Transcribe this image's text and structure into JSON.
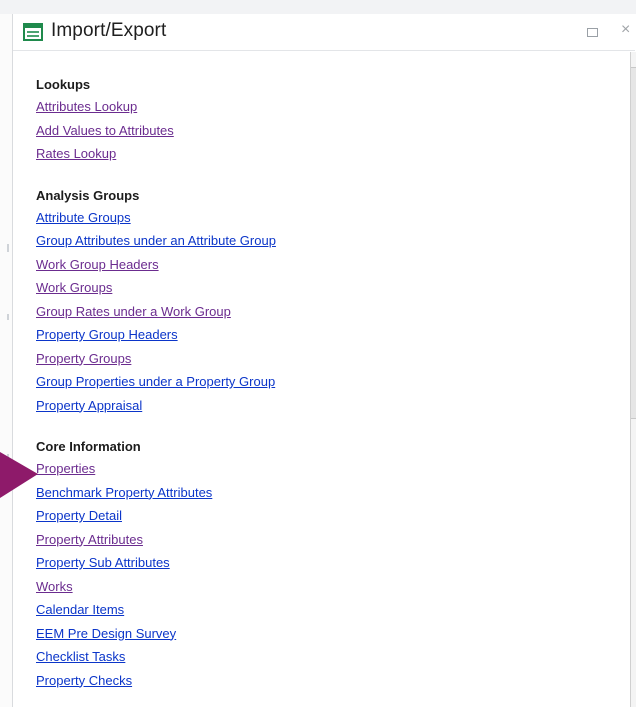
{
  "window": {
    "title": "Import/Export",
    "icon": "form-icon",
    "controls": {
      "restore": "restore-icon",
      "close": "×"
    }
  },
  "sections": [
    {
      "heading": "Lookups",
      "links": [
        {
          "label": "Attributes Lookup",
          "state": "visited"
        },
        {
          "label": "Add Values to Attributes",
          "state": "visited"
        },
        {
          "label": "Rates Lookup",
          "state": "visited"
        }
      ]
    },
    {
      "heading": "Analysis Groups",
      "links": [
        {
          "label": "Attribute Groups",
          "state": "unvisited"
        },
        {
          "label": "Group Attributes under an Attribute Group",
          "state": "unvisited"
        },
        {
          "label": "Work Group Headers",
          "state": "visited"
        },
        {
          "label": "Work Groups",
          "state": "visited"
        },
        {
          "label": "Group Rates under a Work Group",
          "state": "visited"
        },
        {
          "label": "Property Group Headers",
          "state": "unvisited"
        },
        {
          "label": "Property Groups",
          "state": "visited"
        },
        {
          "label": "Group Properties under a Property Group",
          "state": "unvisited"
        },
        {
          "label": "Property Appraisal",
          "state": "unvisited"
        }
      ]
    },
    {
      "heading": "Core Information",
      "links": [
        {
          "label": "Properties",
          "state": "visited"
        },
        {
          "label": "Benchmark Property Attributes",
          "state": "unvisited"
        },
        {
          "label": "Property Detail",
          "state": "unvisited"
        },
        {
          "label": "Property Attributes",
          "state": "visited"
        },
        {
          "label": "Property Sub Attributes",
          "state": "unvisited"
        },
        {
          "label": "Works",
          "state": "visited"
        },
        {
          "label": "Calendar Items",
          "state": "unvisited"
        },
        {
          "label": "EEM Pre Design Survey",
          "state": "unvisited"
        },
        {
          "label": "Checklist Tasks",
          "state": "unvisited"
        },
        {
          "label": "Property Checks",
          "state": "unvisited"
        }
      ]
    }
  ],
  "colors": {
    "link_unvisited": "#0b35c9",
    "link_visited": "#6b2c8f",
    "pointer_arrow": "#8e1a6a",
    "title_icon": "#1f8a4c"
  },
  "annotation": {
    "pointer": "arrow-pointer-icon",
    "target": "Properties"
  }
}
